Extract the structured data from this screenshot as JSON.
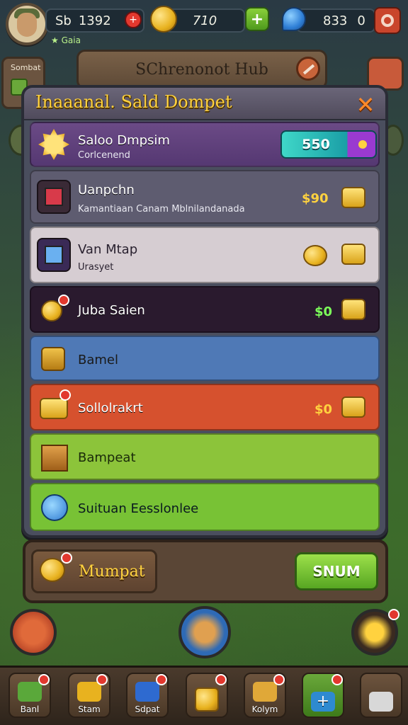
{
  "hud": {
    "player_level": "Sb",
    "player_score": "1392",
    "player_name": "Gaia",
    "coins": "710",
    "gems": "833",
    "gems_extra": "0"
  },
  "side_left": {
    "label": "Sombat"
  },
  "hub_title": "SChrenonot Hub",
  "modal": {
    "title": "Inaaanal. Sald Dompet",
    "balance_row": {
      "label": "Saloo Dmpsim",
      "sub": "Corlcenend",
      "value": "550"
    },
    "rows": [
      {
        "label": "Uanpchn",
        "sub": "Kamantiaan Canam Mblnilandanada",
        "price": "$90",
        "color": "#5e5c70"
      },
      {
        "label": "Van Mtap",
        "sub": "Urasyet",
        "price": "",
        "color": "#d6cdd2"
      },
      {
        "label": "Juba Saien",
        "sub": "",
        "price": "$0",
        "color": "#2a1a2e"
      },
      {
        "label": "Bamel",
        "sub": "",
        "price": "",
        "color": "#4f79b6"
      },
      {
        "label": "Sollolrakrt",
        "sub": "",
        "price": "$0",
        "color": "#d6512e"
      },
      {
        "label": "Bampeat",
        "sub": "",
        "price": "",
        "color": "#8cc43a"
      },
      {
        "label": "Suituan Eesslonlee",
        "sub": "",
        "price": "",
        "color": "#78c235"
      }
    ]
  },
  "footer": {
    "left_button": "Mumpat",
    "right_button": "SNUM"
  },
  "nav": [
    {
      "label": "Banl",
      "icon": "cash-icon"
    },
    {
      "label": "Stam",
      "icon": "gold-icon"
    },
    {
      "label": "Sdpat",
      "icon": "shop-icon"
    },
    {
      "label": "",
      "icon": "coin-icon"
    },
    {
      "label": "Kolym",
      "icon": "stack-icon"
    },
    {
      "label": "",
      "icon": "plus-icon"
    },
    {
      "label": "",
      "icon": "scroll-icon"
    }
  ],
  "colors": {
    "title": "#ffd23f",
    "close": "#ff8a2a",
    "price_gold": "#ffd23f",
    "price_green": "#7cff5a"
  }
}
